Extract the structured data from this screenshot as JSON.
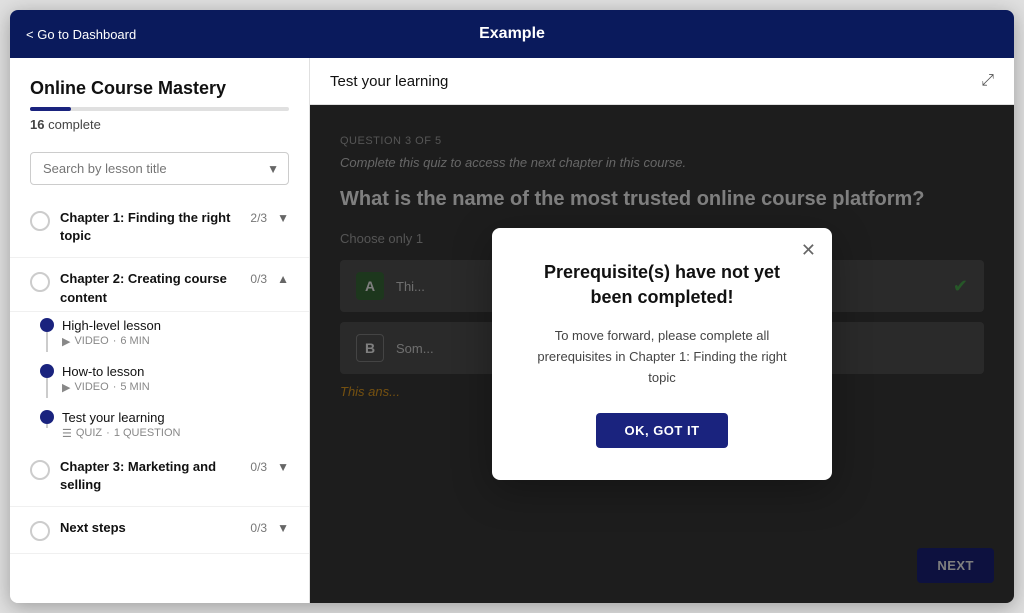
{
  "nav": {
    "back_label": "< Go to Dashboard",
    "title": "Example"
  },
  "sidebar": {
    "course_title": "Online Course Mastery",
    "progress_percent": 16,
    "progress_label": "complete",
    "search_placeholder": "Search by lesson title",
    "chapters": [
      {
        "id": "ch1",
        "name": "Chapter 1: Finding the right topic",
        "progress": "2/3",
        "expanded": false,
        "icon_state": "circle"
      },
      {
        "id": "ch2",
        "name": "Chapter 2: Creating course content",
        "progress": "0/3",
        "expanded": true,
        "icon_state": "circle"
      },
      {
        "id": "ch3",
        "name": "Chapter 3: Marketing and selling",
        "progress": "0/3",
        "expanded": false,
        "icon_state": "circle"
      },
      {
        "id": "ch4",
        "name": "Next steps",
        "progress": "0/3",
        "expanded": false,
        "icon_state": "circle"
      }
    ],
    "lessons": [
      {
        "name": "High-level lesson",
        "type": "VIDEO",
        "duration": "6 MIN"
      },
      {
        "name": "How-to lesson",
        "type": "VIDEO",
        "duration": "5 MIN"
      },
      {
        "name": "Test your learning",
        "type": "QUIZ",
        "duration": "1 QUESTION"
      }
    ]
  },
  "content": {
    "header_title": "Test your learning",
    "quiz_label": "QUESTION 3 OF 5",
    "quiz_subtitle": "Complete this quiz to access the next chapter in this course.",
    "quiz_question": "What is the name of the most trusted online course platform?",
    "quiz_instruction": "Choose only 1",
    "options": [
      {
        "letter": "A",
        "text": "Thi...",
        "correct": true
      },
      {
        "letter": "B",
        "text": "Som...",
        "correct": false
      }
    ],
    "answer_note": "This ans...",
    "next_btn": "NEXT"
  },
  "modal": {
    "title": "Prerequisite(s) have not yet been completed!",
    "body": "To move forward, please complete all prerequisites in Chapter 1: Finding the right topic",
    "cta_label": "OK, GOT IT"
  }
}
